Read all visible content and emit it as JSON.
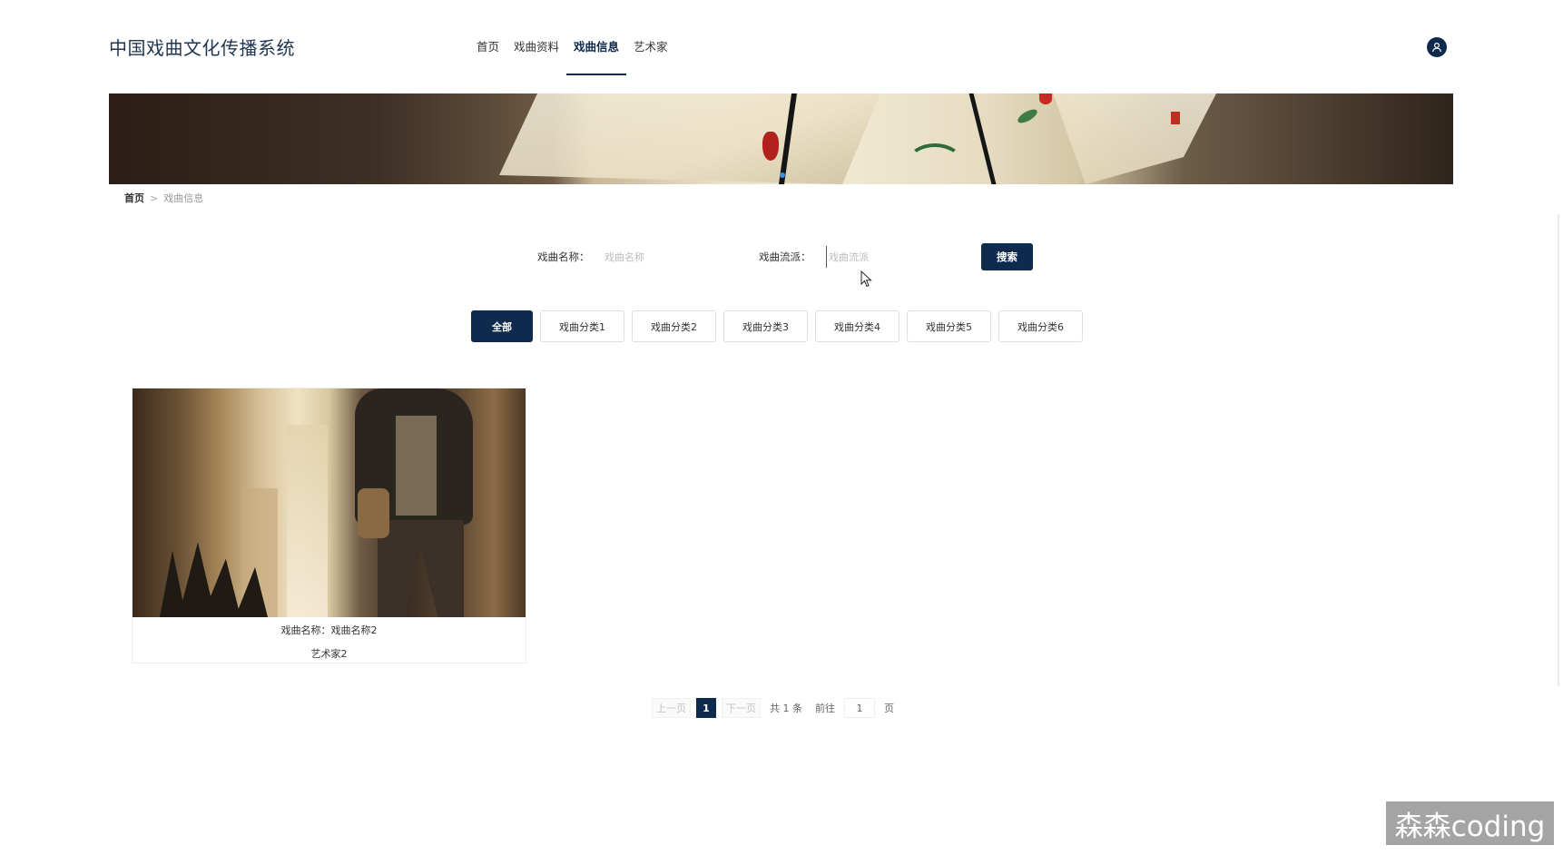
{
  "header": {
    "title": "中国戏曲文化传播系统",
    "nav": [
      {
        "label": "首页"
      },
      {
        "label": "戏曲资料"
      },
      {
        "label": "戏曲信息"
      },
      {
        "label": "艺术家"
      }
    ],
    "active_nav": "戏曲信息",
    "user_icon": "user-icon"
  },
  "breadcrumb": {
    "home": "首页",
    "separator": ">",
    "current": "戏曲信息"
  },
  "search": {
    "name_label": "戏曲名称：",
    "name_placeholder": "戏曲名称",
    "school_label": "戏曲流派：",
    "school_placeholder": "戏曲流派",
    "button": "搜索"
  },
  "categories": [
    "全部",
    "戏曲分类1",
    "戏曲分类2",
    "戏曲分类3",
    "戏曲分类4",
    "戏曲分类5",
    "戏曲分类6"
  ],
  "active_category": "全部",
  "cards": [
    {
      "title": "戏曲名称：戏曲名称2",
      "artist": "艺术家2"
    }
  ],
  "pagination": {
    "prev": "上一页",
    "current": "1",
    "next": "下一页",
    "total": "共 1 条",
    "goto": "前往",
    "goto_value": "1",
    "page_unit": "页"
  },
  "watermark": "森森coding",
  "colors": {
    "primary": "#0e2a4d",
    "title": "#1f3550",
    "carousel_dot": "#3a8ee6"
  }
}
